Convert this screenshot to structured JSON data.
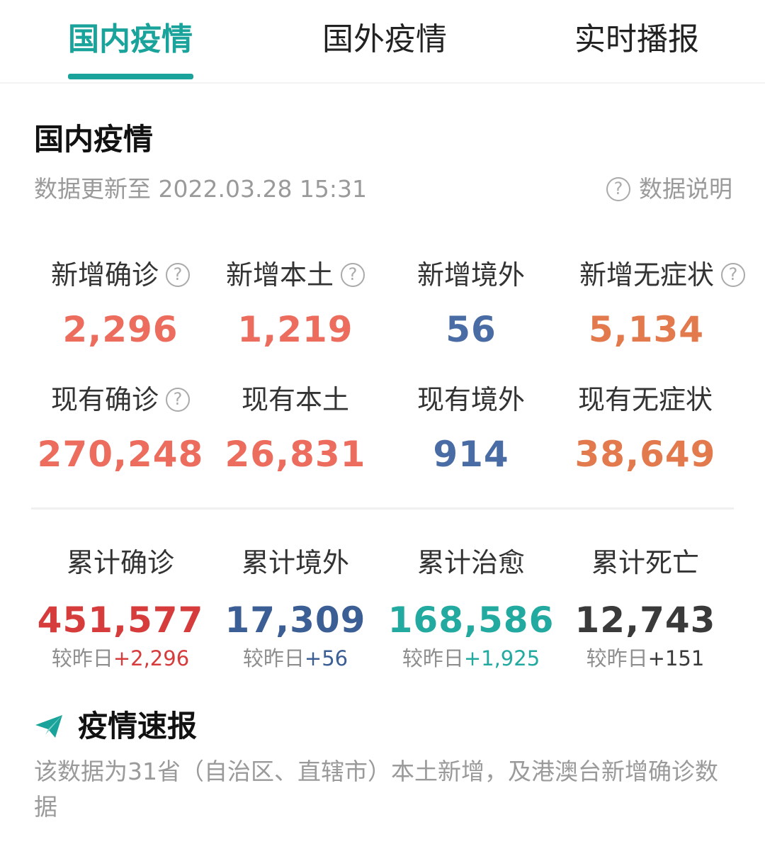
{
  "tabs": [
    {
      "label": "国内疫情",
      "active": true
    },
    {
      "label": "国外疫情",
      "active": false
    },
    {
      "label": "实时播报",
      "active": false
    }
  ],
  "section": {
    "title": "国内疫情",
    "update_text": "数据更新至 2022.03.28 15:31",
    "explain_label": "数据说明",
    "explain_icon": "help-icon"
  },
  "new_stats": [
    {
      "label": "新增确诊",
      "value": "2,296",
      "color": "#ec6d5d",
      "help": true
    },
    {
      "label": "新增本土",
      "value": "1,219",
      "color": "#ec6d5d",
      "help": true
    },
    {
      "label": "新增境外",
      "value": "56",
      "color": "#4a6ca4",
      "help": false
    },
    {
      "label": "新增无症状",
      "value": "5,134",
      "color": "#e27a4e",
      "help": true
    }
  ],
  "current_stats": [
    {
      "label": "现有确诊",
      "value": "270,248",
      "color": "#ec6d5d",
      "help": true
    },
    {
      "label": "现有本土",
      "value": "26,831",
      "color": "#ec6d5d",
      "help": false
    },
    {
      "label": "现有境外",
      "value": "914",
      "color": "#4a6ca4",
      "help": false
    },
    {
      "label": "现有无症状",
      "value": "38,649",
      "color": "#e27a4e",
      "help": false
    }
  ],
  "totals": [
    {
      "label": "累计确诊",
      "value": "451,577",
      "color": "#d63c3c",
      "diff_prefix": "较昨日",
      "diff": "+2,296",
      "diff_color": "#d63c3c"
    },
    {
      "label": "累计境外",
      "value": "17,309",
      "color": "#3b5e94",
      "diff_prefix": "较昨日",
      "diff": "+56",
      "diff_color": "#3b5e94"
    },
    {
      "label": "累计治愈",
      "value": "168,586",
      "color": "#22aaa1",
      "diff_prefix": "较昨日",
      "diff": "+1,925",
      "diff_color": "#22aaa1"
    },
    {
      "label": "累计死亡",
      "value": "12,743",
      "color": "#3a3a3a",
      "diff_prefix": "较昨日",
      "diff": "+151",
      "diff_color": "#3a3a3a"
    }
  ],
  "brief": {
    "icon": "paper-plane-icon",
    "title": "疫情速报",
    "description": "该数据为31省（自治区、直辖市）本土新增，及港澳台新增确诊数据"
  },
  "colors": {
    "accent": "#1aa39a"
  }
}
